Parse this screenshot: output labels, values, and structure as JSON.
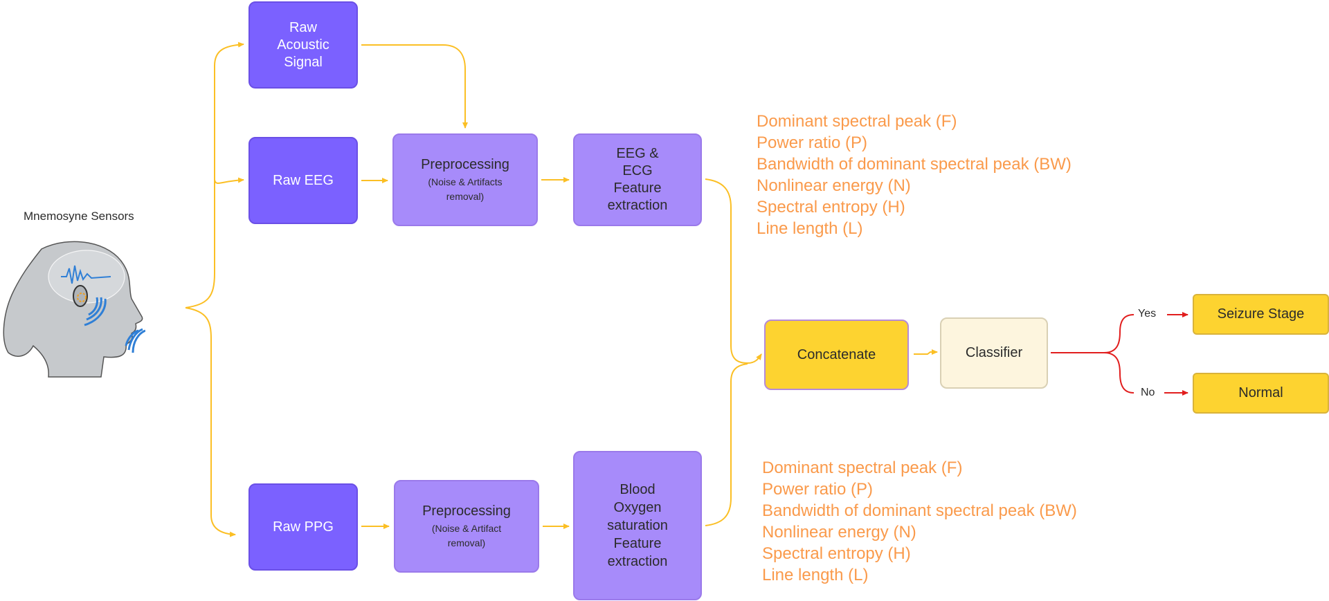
{
  "sensors": {
    "title": "Mnemosyne Sensors",
    "icon": "head-with-earbud-sensor-icon"
  },
  "inputs": {
    "acoustic": "Raw\nAcoustic\nSignal",
    "eeg": "Raw EEG",
    "ppg": "Raw PPG"
  },
  "eeg_branch": {
    "preprocessing_title": "Preprocessing",
    "preprocessing_sub": "(Noise & Artifacts removal)",
    "feature_extraction": "EEG & ECG Feature extraction"
  },
  "ppg_branch": {
    "preprocessing_title": "Preprocessing",
    "preprocessing_sub": "(Noise & Artifact removal)",
    "feature_extraction": "Blood Oxygen saturation Feature extraction"
  },
  "features_top": [
    "Dominant spectral peak (F)",
    "Power ratio (P)",
    "Bandwidth of dominant spectral peak (BW)",
    "Nonlinear energy (N)",
    "Spectral entropy (H)",
    "Line length (L)"
  ],
  "features_bottom": [
    "Dominant spectral peak (F)",
    "Power ratio (P)",
    "Bandwidth of dominant spectral peak (BW)",
    "Nonlinear energy (N)",
    "Spectral entropy (H)",
    "Line length (L)"
  ],
  "fusion": {
    "concatenate": "Concatenate",
    "classifier": "Classifier"
  },
  "decision": {
    "yes": "Yes",
    "no": "No",
    "positive": "Seizure Stage",
    "negative": "Normal"
  },
  "colors": {
    "raw": "#7b61ff",
    "process": "#a78bfa",
    "accent_yellow": "#fdd330",
    "classifier_bg": "#fdf5de",
    "flow": "#fbbf24",
    "decision_flow": "#e11d1d",
    "feature_text": "#fa9a4b"
  }
}
